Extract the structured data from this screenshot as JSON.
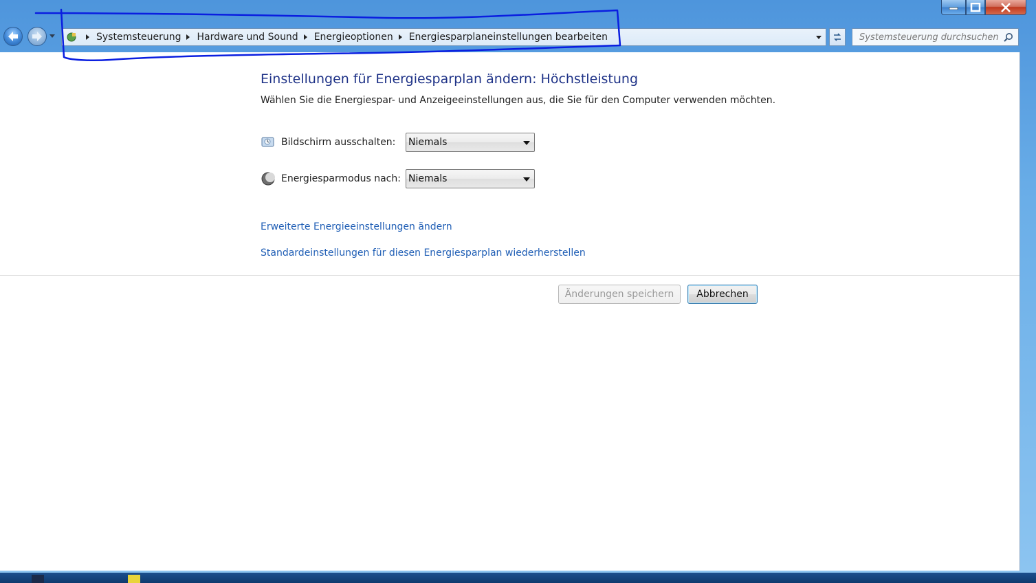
{
  "window": {
    "controls": {
      "minimize_icon": "minimize-icon",
      "maximize_icon": "maximize-icon",
      "close_icon": "close-icon"
    }
  },
  "navigation": {
    "back_icon": "back-arrow-icon",
    "forward_icon": "forward-arrow-icon",
    "breadcrumb": [
      "Systemsteuerung",
      "Hardware und Sound",
      "Energieoptionen",
      "Energiesparplaneinstellungen bearbeiten"
    ],
    "search_placeholder": "Systemsteuerung durchsuchen"
  },
  "main": {
    "title": "Einstellungen für Energiesparplan ändern: Höchstleistung",
    "subtitle": "Wählen Sie die Energiespar- und Anzeigeeinstellungen aus, die Sie für den Computer verwenden möchten.",
    "settings": [
      {
        "label": "Bildschirm ausschalten:",
        "value": "Niemals",
        "icon": "display-icon"
      },
      {
        "label": "Energiesparmodus nach:",
        "value": "Niemals",
        "icon": "sleep-moon-icon"
      }
    ],
    "links": [
      "Erweiterte Energieeinstellungen ändern",
      "Standardeinstellungen für diesen Energiesparplan wiederherstellen"
    ],
    "buttons": {
      "save": "Änderungen speichern",
      "cancel": "Abbrechen"
    }
  },
  "colors": {
    "title": "#1e3287",
    "link": "#1f5eb5",
    "annotation_stroke": "#0a1ee0"
  }
}
